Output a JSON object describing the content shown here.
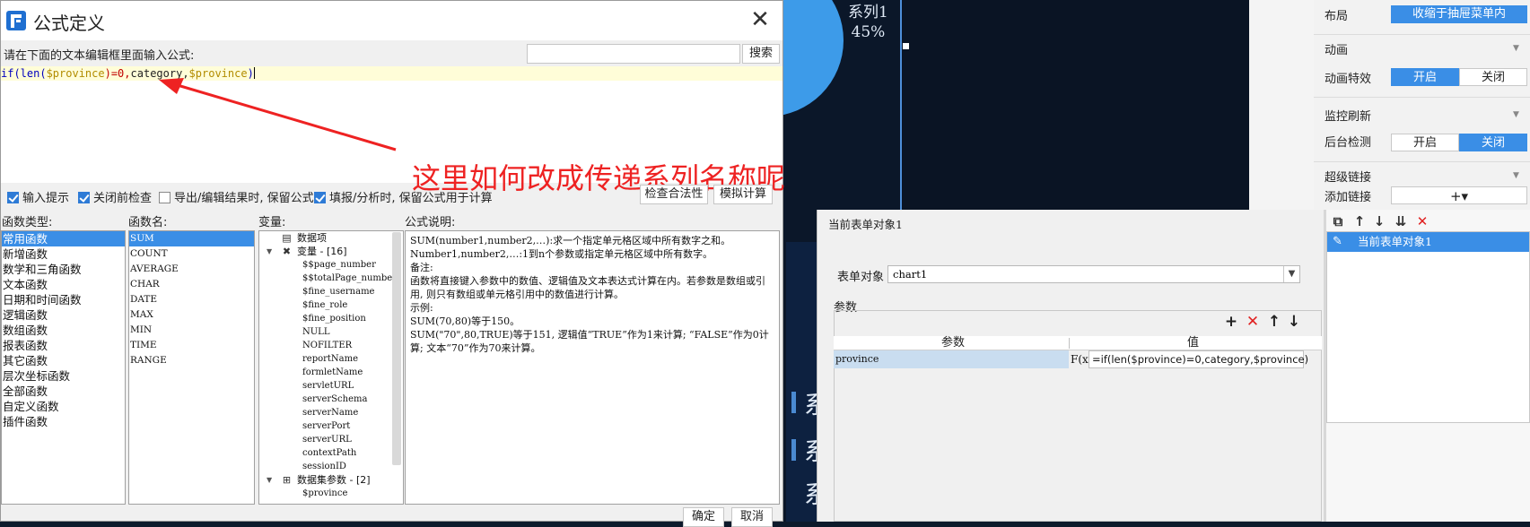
{
  "background": {
    "pie_label_line1": "系列1",
    "pie_label_line2": "45%",
    "glyphs": [
      "系",
      "系",
      "系"
    ]
  },
  "dialog": {
    "title": "公式定义",
    "close_symbol": "✕",
    "prompt": "请在下面的文本编辑框里面输入公式:",
    "search_placeholder": "",
    "search_button": "搜索",
    "formula": {
      "tokens": [
        "if(len(",
        "$province",
        ")=0,",
        "category",
        ",",
        "$province",
        ")"
      ]
    },
    "annotation": "这里如何改成传递系列名称呢",
    "options": {
      "input_hint": "输入提示",
      "check_on_close": "关闭前检查",
      "keep_on_export": "导出/编辑结果时, 保留公式",
      "keep_on_fill": "填报/分析时, 保留公式用于计算"
    },
    "check_validity": "检查合法性",
    "simulate": "模拟计算",
    "headers": {
      "fn_type": "函数类型:",
      "fn_name": "函数名:",
      "variables": "变量:",
      "description": "公式说明:"
    },
    "fn_types": [
      "常用函数",
      "新增函数",
      "数学和三角函数",
      "文本函数",
      "日期和时间函数",
      "逻辑函数",
      "数组函数",
      "报表函数",
      "其它函数",
      "层次坐标函数",
      "全部函数",
      "自定义函数",
      "插件函数"
    ],
    "fn_names": [
      "SUM",
      "COUNT",
      "AVERAGE",
      "CHAR",
      "DATE",
      "MAX",
      "MIN",
      "TIME",
      "RANGE"
    ],
    "var_tree": {
      "data_items": "数据项",
      "variables_group": "变量 - [16]",
      "variables": [
        "$$page_number",
        "$$totalPage_number",
        "$fine_username",
        "$fine_role",
        "$fine_position",
        "NULL",
        "NOFILTER",
        "reportName",
        "formletName",
        "servletURL",
        "serverSchema",
        "serverName",
        "serverPort",
        "serverURL",
        "contextPath",
        "sessionID"
      ],
      "dataset_params_group": "数据集参数 - [2]",
      "dataset_params": [
        "$province"
      ]
    },
    "description_lines": [
      "SUM(number1,number2,…):求一个指定单元格区域中所有数字之和。",
      "Number1,number2,…:1到n个参数或指定单元格区域中所有数字。",
      "备注:",
      "函数将直接键入参数中的数值、逻辑值及文本表达式计算在内。若参数是数组或引用, 则只有数组或单元格引用中的数值进行计算。",
      "示例:",
      "SUM(70,80)等于150。",
      "SUM(\"70\",80,TRUE)等于151, 逻辑值“TRUE”作为1来计算; “FALSE”作为0计算; 文本“70”作为70来计算。"
    ],
    "ok": "确定",
    "cancel": "取消"
  },
  "props": {
    "layout_label": "布局",
    "layout_value": "收缩于抽屉菜单内",
    "animation_section": "动画",
    "animation_effect_label": "动画特效",
    "on": "开启",
    "off": "关闭",
    "monitor_section": "监控刷新",
    "backend_check_label": "后台检测",
    "hyperlink_section": "超级链接",
    "add_link_label": "添加链接",
    "add_link_symbol": "+▾"
  },
  "form_panel": {
    "title": "当前表单对象1",
    "object_label": "表单对象",
    "object_value": "chart1",
    "params_label": "参数",
    "col_param": "参数",
    "col_value": "值",
    "row_param": "province",
    "row_fx": "F(x)",
    "row_value": "=if(len($province)=0,category,$province)"
  },
  "list_panel": {
    "item_label": "当前表单对象1"
  },
  "colors": {
    "accent": "#3a8ee6",
    "annotation": "#ee2222",
    "delete": "#e02020"
  }
}
